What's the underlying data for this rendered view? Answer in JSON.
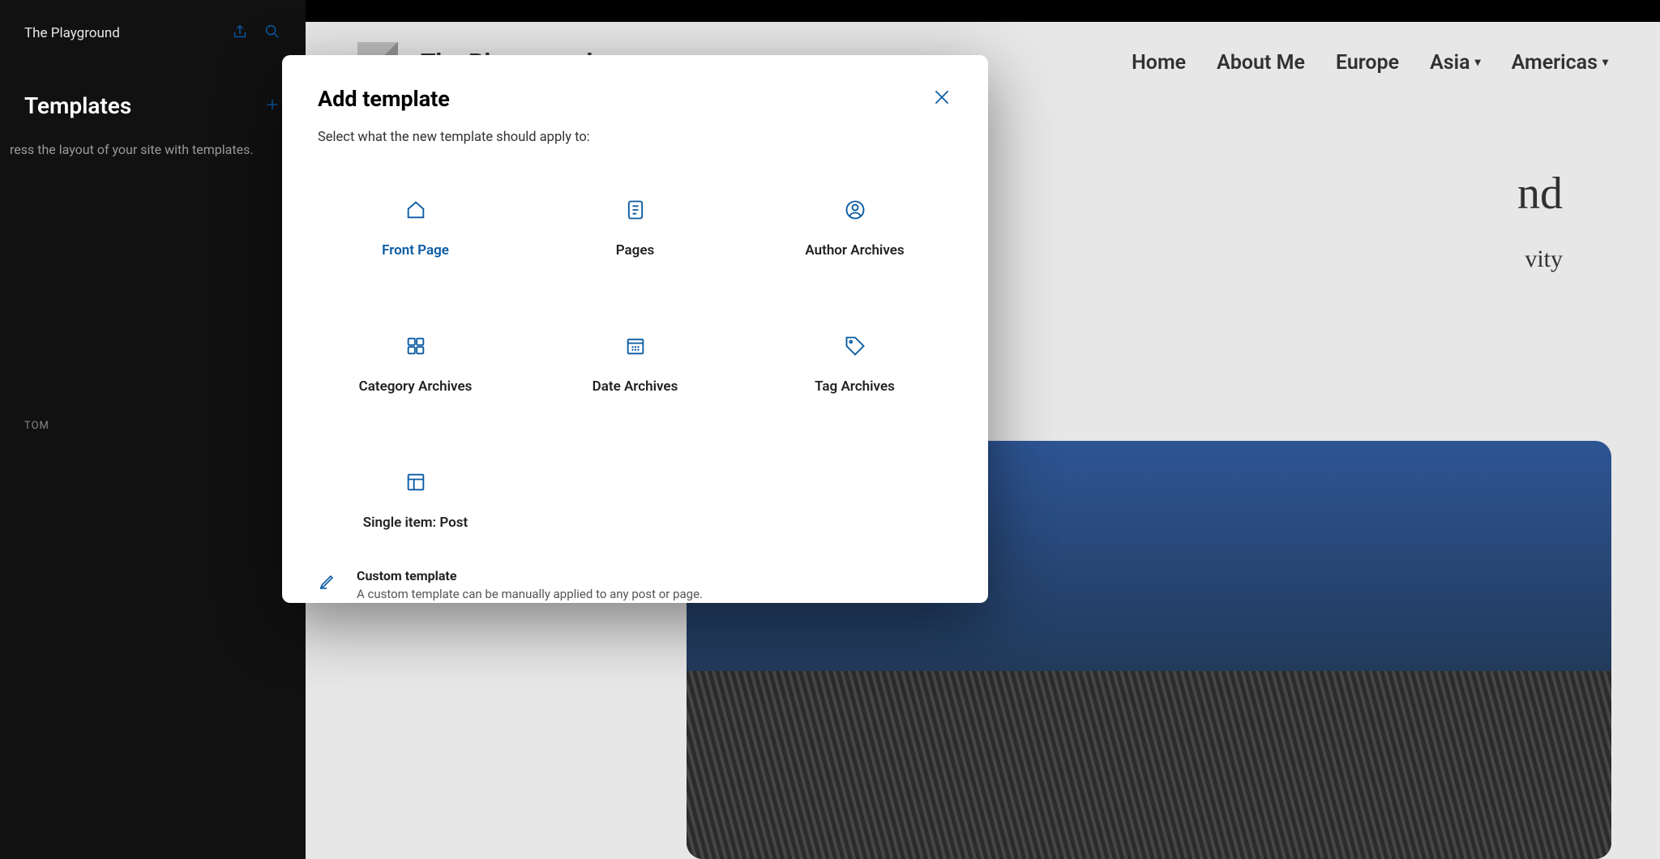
{
  "sidebar": {
    "site_name": "The Playground",
    "section_title": "Templates",
    "description": "ress the layout of your site with templates.",
    "custom_heading": "TOM",
    "items_top": [
      "",
      "",
      "",
      "",
      "",
      ""
    ],
    "items_bottom": [
      "",
      "",
      "",
      ""
    ]
  },
  "preview": {
    "site_title": "The Playground",
    "nav": [
      {
        "label": "Home",
        "dropdown": false
      },
      {
        "label": "About Me",
        "dropdown": false
      },
      {
        "label": "Europe",
        "dropdown": false
      },
      {
        "label": "Asia",
        "dropdown": true
      },
      {
        "label": "Americas",
        "dropdown": true
      }
    ],
    "hero_big_partial": "nd",
    "hero_sub_partial": "vity"
  },
  "modal": {
    "title": "Add template",
    "subtitle": "Select what the new template should apply to:",
    "templates": [
      {
        "label": "Front Page",
        "icon": "home-icon",
        "active": true
      },
      {
        "label": "Pages",
        "icon": "page-icon",
        "active": false
      },
      {
        "label": "Author Archives",
        "icon": "person-icon",
        "active": false
      },
      {
        "label": "Category Archives",
        "icon": "grid-icon",
        "active": false
      },
      {
        "label": "Date Archives",
        "icon": "calendar-icon",
        "active": false
      },
      {
        "label": "Tag Archives",
        "icon": "tag-icon",
        "active": false
      },
      {
        "label": "Single item: Post",
        "icon": "layout-icon",
        "active": false
      }
    ],
    "custom": {
      "title": "Custom template",
      "desc": "A custom template can be manually applied to any post or page."
    }
  },
  "colors": {
    "accent": "#0a5aa3"
  }
}
